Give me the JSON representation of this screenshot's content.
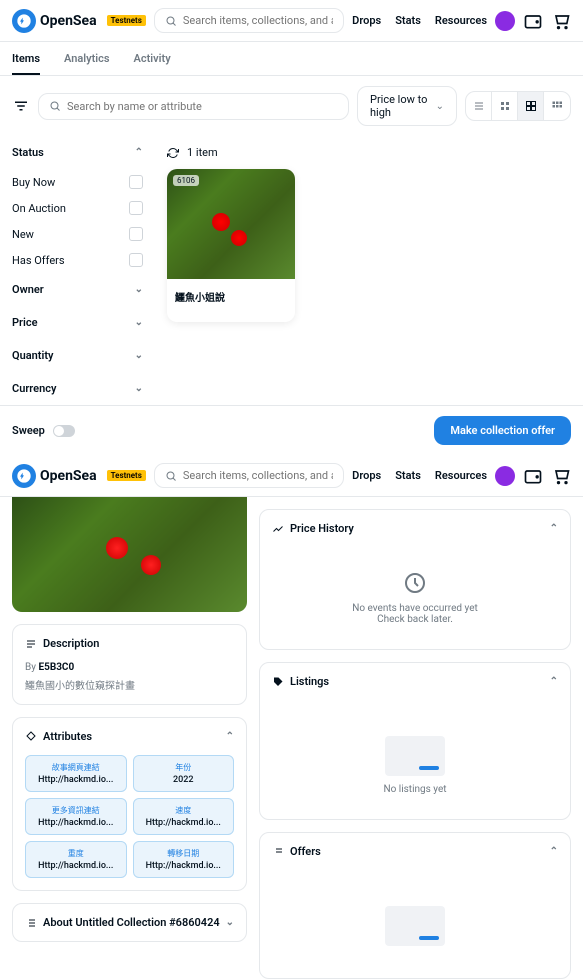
{
  "brand": "OpenSea",
  "badge": "Testnets",
  "search_placeholder": "Search items, collections, and accounts",
  "nav": {
    "drops": "Drops",
    "stats": "Stats",
    "resources": "Resources"
  },
  "tabs": {
    "items": "Items",
    "analytics": "Analytics",
    "activity": "Activity"
  },
  "filter_search_placeholder": "Search by name or attribute",
  "sort_label": "Price low to high",
  "item_count": "1 item",
  "filters": {
    "status": "Status",
    "buy_now": "Buy Now",
    "on_auction": "On Auction",
    "new": "New",
    "has_offers": "Has Offers",
    "owner": "Owner",
    "price": "Price",
    "quantity": "Quantity",
    "currency": "Currency"
  },
  "item": {
    "tag": "6106",
    "name": "鱷魚小姐說"
  },
  "sweep": "Sweep",
  "offer_btn": "Make collection offer",
  "detail": {
    "description_title": "Description",
    "by": "By",
    "creator": "E5B3C0",
    "desc_text": "鱷魚國小的數位窺探計畫",
    "attributes_title": "Attributes",
    "attrs": [
      {
        "k": "故事網頁連結",
        "v": "Http://hackmd.io..."
      },
      {
        "k": "年份",
        "v": "2022"
      },
      {
        "k": "更多資訊連結",
        "v": "Http://hackmd.io..."
      },
      {
        "k": "速度",
        "v": "Http://hackmd.io..."
      },
      {
        "k": "重度",
        "v": "Http://hackmd.io..."
      },
      {
        "k": "轉移日期",
        "v": "Http://hackmd.io..."
      }
    ],
    "about_title": "About Untitled Collection #6860424",
    "price_history": "Price History",
    "no_events": "No events have occurred yet",
    "check_back": "Check back later.",
    "listings": "Listings",
    "no_listings": "No listings yet",
    "offers": "Offers"
  }
}
